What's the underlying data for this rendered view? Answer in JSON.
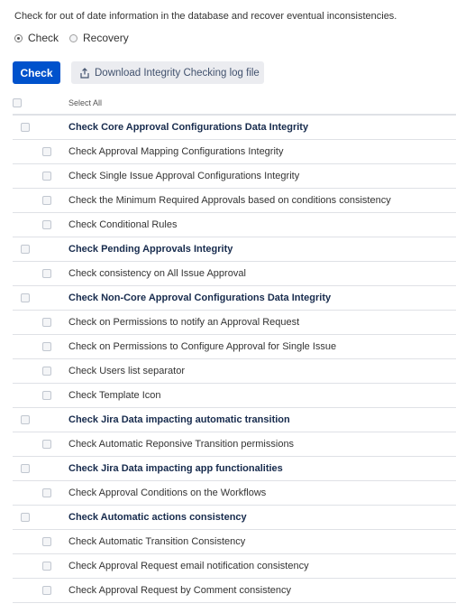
{
  "intro_text": "Check for out of date information in the database and recover eventual inconsistencies.",
  "mode": {
    "options": [
      {
        "label": "Check",
        "checked": true
      },
      {
        "label": "Recovery",
        "checked": false
      }
    ]
  },
  "actions": {
    "check_label": "Check",
    "download_label": "Download Integrity Checking log file"
  },
  "table": {
    "select_all_label": "Select All",
    "rows": [
      {
        "level": 0,
        "label": "Check Core Approval Configurations Data Integrity"
      },
      {
        "level": 1,
        "label": "Check Approval Mapping Configurations Integrity"
      },
      {
        "level": 1,
        "label": "Check Single Issue Approval Configurations Integrity"
      },
      {
        "level": 1,
        "label": "Check the Minimum Required Approvals based on conditions consistency"
      },
      {
        "level": 1,
        "label": "Check Conditional Rules"
      },
      {
        "level": 0,
        "label": "Check Pending Approvals Integrity"
      },
      {
        "level": 1,
        "label": "Check consistency on All Issue Approval"
      },
      {
        "level": 0,
        "label": "Check Non-Core Approval Configurations Data Integrity"
      },
      {
        "level": 1,
        "label": "Check on Permissions to notify an Approval Request"
      },
      {
        "level": 1,
        "label": "Check on Permissions to Configure Approval for Single Issue"
      },
      {
        "level": 1,
        "label": "Check Users list separator"
      },
      {
        "level": 1,
        "label": "Check Template Icon"
      },
      {
        "level": 0,
        "label": "Check Jira Data impacting automatic transition"
      },
      {
        "level": 1,
        "label": "Check Automatic Reponsive Transition permissions"
      },
      {
        "level": 0,
        "label": "Check Jira Data impacting app functionalities"
      },
      {
        "level": 1,
        "label": "Check Approval Conditions on the Workflows"
      },
      {
        "level": 0,
        "label": "Check Automatic actions consistency"
      },
      {
        "level": 1,
        "label": "Check Automatic Transition Consistency"
      },
      {
        "level": 1,
        "label": "Check Approval Request email notification consistency"
      },
      {
        "level": 1,
        "label": "Check Approval Request by Comment consistency"
      }
    ]
  },
  "colors": {
    "primary": "#0052cc",
    "secondary_button": "#ebecf0",
    "divider": "#dfe1e6"
  }
}
